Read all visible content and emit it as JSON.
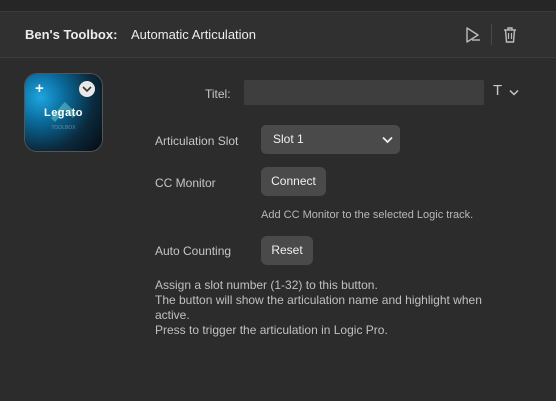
{
  "header": {
    "plugin_name": "Ben's Toolbox:",
    "action_name": "Automatic Articulation",
    "icons": [
      "play-icon",
      "trash-icon"
    ]
  },
  "key_preview": {
    "title": "Legato",
    "subtitle": "TOOLBOX",
    "plus_icon": "plus-icon",
    "menu_icon": "chevron-down-icon"
  },
  "form": {
    "title_label": "Titel:",
    "title_value": "",
    "title_format_icon": "T",
    "articulation_slot_label": "Articulation Slot",
    "articulation_slot_value": "Slot 1",
    "cc_monitor_label": "CC Monitor",
    "connect_label": "Connect",
    "cc_monitor_hint": "Add CC Monitor to the selected Logic track.",
    "auto_counting_label": "Auto Counting",
    "reset_label": "Reset"
  },
  "description": [
    "Assign a slot number (1-32) to this button.",
    "The button will show the articulation name and highlight when",
    "active.",
    "Press to trigger the articulation in Logic Pro."
  ],
  "colors": {
    "background": "#2c2c2c",
    "control": "#4a4a4a",
    "key_accent": "#1ea6e0"
  }
}
